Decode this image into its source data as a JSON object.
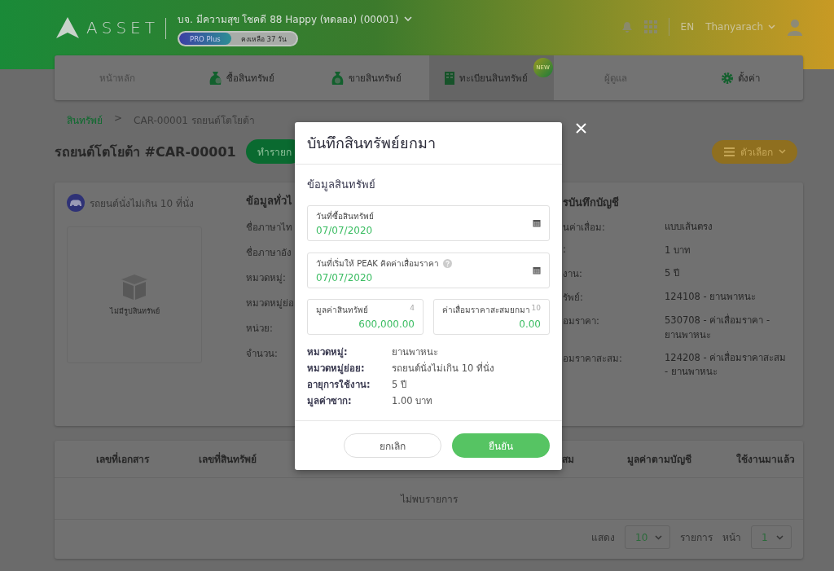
{
  "header": {
    "logo": "ASSET",
    "company": "บจ. มีความสุข โชคดี 88 Happy (ทดลอง) (00001)",
    "plan": "PRO Plus",
    "trial": "คงเหลือ 37 วัน",
    "language": "EN",
    "user": "Thanyarach"
  },
  "nav": [
    {
      "label": "หน้าหลัก",
      "kind": "plain",
      "selected": false,
      "disabled": true
    },
    {
      "label": "ซื้อสินทรัพย์",
      "kind": "buy",
      "selected": false,
      "disabled": false
    },
    {
      "label": "ขายสินทรัพย์",
      "kind": "sell",
      "selected": false,
      "disabled": false
    },
    {
      "label": "ทะเบียนสินทรัพย์",
      "kind": "register",
      "selected": true,
      "disabled": false,
      "badge": "NEW"
    },
    {
      "label": "ผู้ดูแล",
      "kind": "plain",
      "selected": false,
      "disabled": true
    },
    {
      "label": "ตั้งค่า",
      "kind": "settings",
      "selected": false,
      "disabled": false
    }
  ],
  "breadcrumb": {
    "items": [
      {
        "label": "สินทรัพย์",
        "link": true
      },
      {
        "label": "CAR-00001 รถยนต์โตโยต้า",
        "link": false
      }
    ],
    "separator": ">"
  },
  "page": {
    "title": "รถยนต์โตโยต้า #CAR-00001",
    "action_button": "ทำรายก",
    "options_button": "ตัวเลือก"
  },
  "asset_card": {
    "category": "รถยนต์นั่งไม่เกิน 10 ที่นั่ง",
    "no_image": "ไม่มีรูปสินทรัพย์",
    "general": {
      "heading": "ข้อมูลทั่วไ",
      "labels": [
        "ชื่อภาษาไท",
        "ชื่อภาษาอัง",
        "หมวดหมู่:",
        "หมวดหมู่ย่อ",
        "หน่วย:",
        "จำนวน:"
      ]
    },
    "accounting": {
      "heading": "รบันทึกบัญชี",
      "rows": [
        {
          "label": "นค่าเสื่อม:",
          "value": "แบบเส้นตรง"
        },
        {
          "label": ":",
          "value": "1 บาท"
        },
        {
          "label": "งาน:",
          "value": "5 ปี"
        },
        {
          "label": "รัพย์:",
          "value": "124108 - ยานพาหนะ"
        },
        {
          "label": "อมราคา:",
          "value": "530708 - ค่าเสื่อมราคา - ยานพาหนะ"
        },
        {
          "label": "อมราคาสะสม:",
          "value": "124208 - ค่าเสื่อมราคาสะสม - ยานพาหนะ"
        }
      ]
    }
  },
  "table": {
    "columns": [
      "เลขที่เอกสาร",
      "เลขที่สินทรัพย์",
      "สม",
      "มูลค่าตามบัญชี",
      "ใช้งานมาแล้ว"
    ],
    "empty": "ไม่พบรายการ",
    "pagination": {
      "show_label": "แสดง",
      "page_size": "10",
      "rows_label": "รายการ",
      "page_label": "หน้า",
      "page": "1"
    }
  },
  "modal": {
    "title": "บันทึกสินทรัพย์ยกมา",
    "section": "ข้อมูลสินทรัพย์",
    "fields": [
      {
        "kind": "date",
        "label": "วันที่ซื้อสินทรัพย์",
        "value": "07/07/2020",
        "help": false
      },
      {
        "kind": "date",
        "label": "วันที่เริ่มให้ PEAK คิดค่าเสื่อมราคา",
        "value": "07/07/2020",
        "help": true
      },
      {
        "kind": "amount",
        "label": "มูลค่าสินทรัพย์",
        "value": "600,000.00",
        "counter": "4"
      },
      {
        "kind": "amount",
        "label": "ค่าเสื่อมราคาสะสมยกมา",
        "value": "0.00",
        "counter": "10"
      }
    ],
    "info": [
      {
        "label": "หมวดหมู่:",
        "value": "ยานพาหนะ"
      },
      {
        "label": "หมวดหมู่ย่อย:",
        "value": "รถยนต์นั่งไม่เกิน 10 ที่นั่ง"
      },
      {
        "label": "อายุการใช้งาน:",
        "value": "5 ปี"
      },
      {
        "label": "มูลค่าซาก:",
        "value": "1.00 บาท"
      }
    ],
    "cancel": "ยกเลิก",
    "confirm": "ยืนยัน"
  }
}
